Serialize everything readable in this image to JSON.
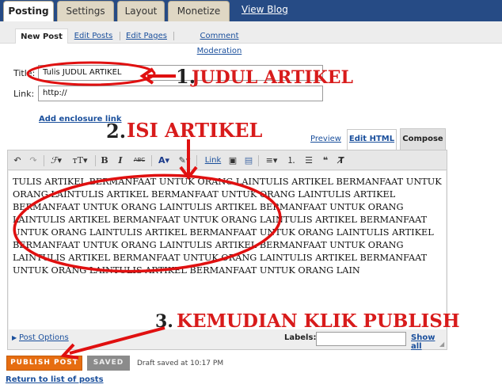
{
  "top_tabs": [
    "Posting",
    "Settings",
    "Layout",
    "Monetize"
  ],
  "view_blog": "View Blog",
  "sub_tabs": [
    "New Post",
    "Edit Posts",
    "Edit Pages",
    "Comment Moderation"
  ],
  "form": {
    "title_label": "Title:",
    "title_value": "Tulis JUDUL ARTIKEL",
    "link_label": "Link:",
    "link_value": "http://",
    "add_enclosure": "Add enclosure link"
  },
  "editor": {
    "preview": "Preview",
    "edit_html": "Edit HTML",
    "compose": "Compose",
    "toolbar": {
      "undo_icon": "undo-icon",
      "redo_icon": "redo-icon",
      "font_icon": "font-family-icon",
      "size_icon": "font-size-icon",
      "bold": "B",
      "italic": "I",
      "strike": "ABC",
      "link": "Link"
    },
    "body_text": "TULIS ARTIKEL BERMANFAAT UNTUK ORANG LAINTULIS ARTIKEL BERMANFAAT UNTUK ORANG LAINTULIS ARTIKEL BERMANFAAT UNTUK ORANG LAINTULIS ARTIKEL BERMANFAAT UNTUK ORANG LAINTULIS ARTIKEL BERMANFAAT UNTUK ORANG LAINTULIS ARTIKEL BERMANFAAT UNTUK ORANG LAINTULIS ARTIKEL BERMANFAAT UNTUK ORANG LAINTULIS ARTIKEL BERMANFAAT UNTUK ORANG LAINTULIS ARTIKEL BERMANFAAT UNTUK ORANG LAINTULIS ARTIKEL BERMANFAAT UNTUK ORANG LAINTULIS ARTIKEL BERMANFAAT UNTUK ORANG LAINTULIS ARTIKEL BERMANFAAT UNTUK ORANG LAINTULIS ARTIKEL BERMANFAAT UNTUK ORANG LAIN",
    "post_options": "Post Options",
    "labels_label": "Labels:",
    "labels_value": "",
    "show_all": "Show all"
  },
  "annotations": {
    "one_num": "1.",
    "one_text": "JUDUL ARTIKEL",
    "two_num": "2.",
    "two_text": "ISI ARTIKEL",
    "three_num": "3.",
    "three_text": "KEMUDIAN KLIK PUBLISH"
  },
  "bottom": {
    "publish": "PUBLISH POST",
    "saved": "SAVED",
    "draft_status": "Draft saved at 10:17 PM",
    "return_link": "Return to list of posts"
  },
  "colors": {
    "nav_blue": "#264b85",
    "tab_tan": "#dfd7c4",
    "link_blue": "#1a4f9c",
    "annotation_red": "#d81b1b",
    "publish_orange": "#e66d11"
  }
}
